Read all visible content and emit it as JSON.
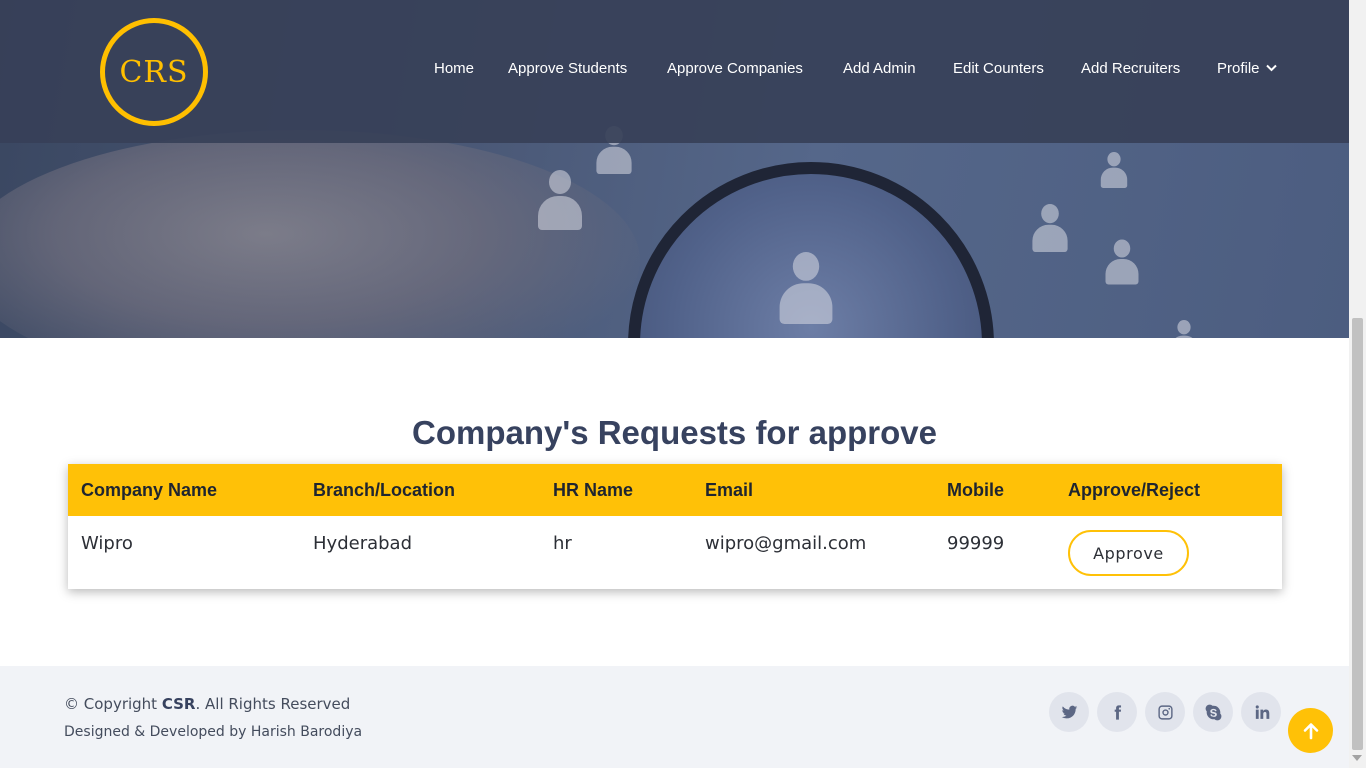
{
  "brand": {
    "logo_text": "CRS",
    "accent_color": "#ffc107"
  },
  "nav": {
    "items": [
      {
        "label": "Home"
      },
      {
        "label": "Approve Students"
      },
      {
        "label": "Approve Companies"
      },
      {
        "label": "Add Admin"
      },
      {
        "label": "Edit Counters"
      },
      {
        "label": "Add Recruiters"
      },
      {
        "label": "Profile",
        "icon": "chevron-down-icon"
      }
    ]
  },
  "main": {
    "title": "Company's Requests for approve",
    "table": {
      "headers": [
        "Company Name",
        "Branch/Location",
        "HR Name",
        "Email",
        "Mobile",
        "Approve/Reject"
      ],
      "rows": [
        {
          "company": "Wipro",
          "branch": "Hyderabad",
          "hr": "hr",
          "email": "wipro@gmail.com",
          "mobile": "99999",
          "action_label": "Approve"
        }
      ]
    }
  },
  "footer": {
    "copyright_prefix": "© Copyright ",
    "copyright_brand": "CSR",
    "copyright_suffix": ". All Rights Reserved",
    "designed_by": "Designed & Developed by Harish Barodiya",
    "social": [
      "twitter-icon",
      "facebook-icon",
      "instagram-icon",
      "skype-icon",
      "linkedin-icon"
    ]
  }
}
